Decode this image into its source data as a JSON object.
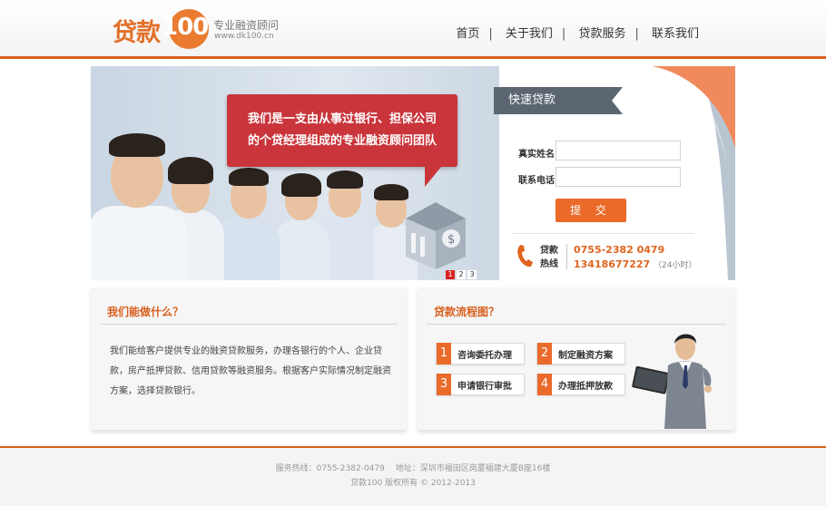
{
  "header": {
    "logo_text": "贷款",
    "logo_number": "100",
    "tagline": "专业融资顾问",
    "domain": "www.dk100.cn",
    "nav": [
      "首页",
      "关于我们",
      "贷款服务",
      "联系我们"
    ]
  },
  "banner": {
    "bubble_line1": "我们是一支由从事过银行、担保公司",
    "bubble_line2": "的个贷经理组成的专业融资顾问团队",
    "slider_pages": [
      "1",
      "2",
      "3"
    ],
    "active_page": "1"
  },
  "quick_loan": {
    "title": "快速贷款",
    "name_label": "真实姓名:",
    "name_value": "",
    "phone_label": "联系电话:",
    "phone_value": "",
    "submit_label": "提 交",
    "hotline_label_1": "贷款",
    "hotline_label_2": "热线",
    "hotline_number_1": "0755-2382 0479",
    "hotline_number_2": "13418677227",
    "hotline_hours": "（24小时）"
  },
  "about": {
    "title": "我们能做什么？",
    "text": "我们能给客户提供专业的融资贷款服务，办理各银行的个人、企业贷款，房产抵押贷款、信用贷款等融资服务。根据客户实际情况制定融资方案，选择贷款银行。"
  },
  "process": {
    "title": "贷款流程图？",
    "steps": [
      {
        "num": "1",
        "label": "咨询委托办理"
      },
      {
        "num": "2",
        "label": "制定融资方案"
      },
      {
        "num": "3",
        "label": "申请银行审批"
      },
      {
        "num": "4",
        "label": "办理抵押放款"
      }
    ]
  },
  "footer": {
    "line1": "服务热线：0755-2382-0479　 地址：深圳市福田区岗厦福建大厦B座16楼",
    "line2": "贷款100 版权所有 © 2012-2013"
  },
  "colors": {
    "accent": "#d9601e",
    "button": "#ea6a2a",
    "bubble": "#c9353b",
    "form_title_bg": "#5b6670"
  }
}
